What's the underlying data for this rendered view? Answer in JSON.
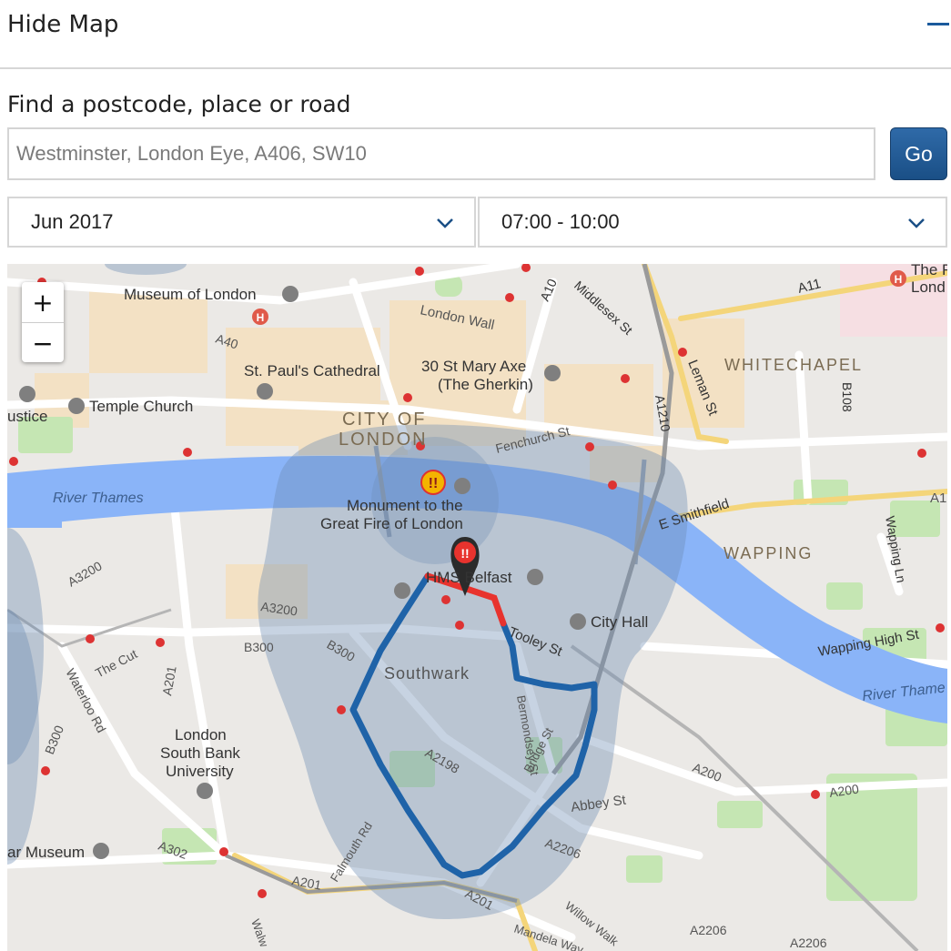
{
  "header": {
    "title": "Hide Map"
  },
  "search": {
    "label": "Find a postcode, place or road",
    "placeholder": "Westminster, London Eye, A406, SW10",
    "value": "",
    "go_label": "Go"
  },
  "filters": {
    "month": "Jun 2017",
    "time": "07:00 - 10:00"
  },
  "map": {
    "zoom_in": "+",
    "zoom_out": "−",
    "colors": {
      "route": "#1f63a8",
      "congestion": "#e8332e",
      "zone": "#6b8bb3",
      "water": "#8ab4f8",
      "park": "#c5e6b3"
    },
    "labels": {
      "museum_of_london": "Museum of London",
      "london_wall": "London Wall",
      "st_pauls": "St. Paul's Cathedral",
      "gherkin_1": "30 St Mary Axe",
      "gherkin_2": "(The Gherkin)",
      "temple_church": "Temple Church",
      "justice": "ustice",
      "city_1": "CITY OF",
      "city_2": "LONDON",
      "fenchurch": "Fenchurch St",
      "river_thames_w": "River Thames",
      "river_thames_e": "River Thame",
      "monument_1": "Monument to the",
      "monument_2": "Great Fire of London",
      "hms_belfast": "HMS Belfast",
      "city_hall": "City Hall",
      "tooley": "Tooley St",
      "southwark": "Southwark",
      "whitechapel": "WHITECHAPEL",
      "wapping": "WAPPING",
      "wapping_high": "Wapping High St",
      "wapping_ln": "Wapping Ln",
      "e_smithfield": "E Smithfield",
      "leman": "Leman St",
      "a1210": "A1210",
      "b108": "B108",
      "a11": "A11",
      "a10": "A10",
      "middlesex": "Middlesex St",
      "a40": "A40",
      "a3200_w": "A3200",
      "a3200_c": "A3200",
      "b300_c": "B300",
      "b300_s": "B300",
      "b300_w": "B300",
      "the_cut": "The Cut",
      "a201_w": "A201",
      "waterloo": "Waterloo Rd",
      "lsbu_1": "London",
      "lsbu_2": "South Bank",
      "lsbu_3": "University",
      "bermondsey": "Bermondsey St",
      "a2198": "A2198",
      "abbey": "Abbey St",
      "a200_1": "A200",
      "a200_2": "A200",
      "a2206_1": "A2206",
      "a2206_2": "A2206",
      "a2206_3": "A2206",
      "museum_left": "ar Museum",
      "a302": "A302",
      "falmouth": "Falmouth Rd",
      "a201_s": "A201",
      "a201_se": "A201",
      "willow": "Willow Walk",
      "mandela": "Mandela Way",
      "walw": "Walw",
      "royal_london_1": "The R",
      "royal_london_2": "Lond",
      "a1_e": "A1",
      "bridge_st": "Bridge St"
    }
  }
}
